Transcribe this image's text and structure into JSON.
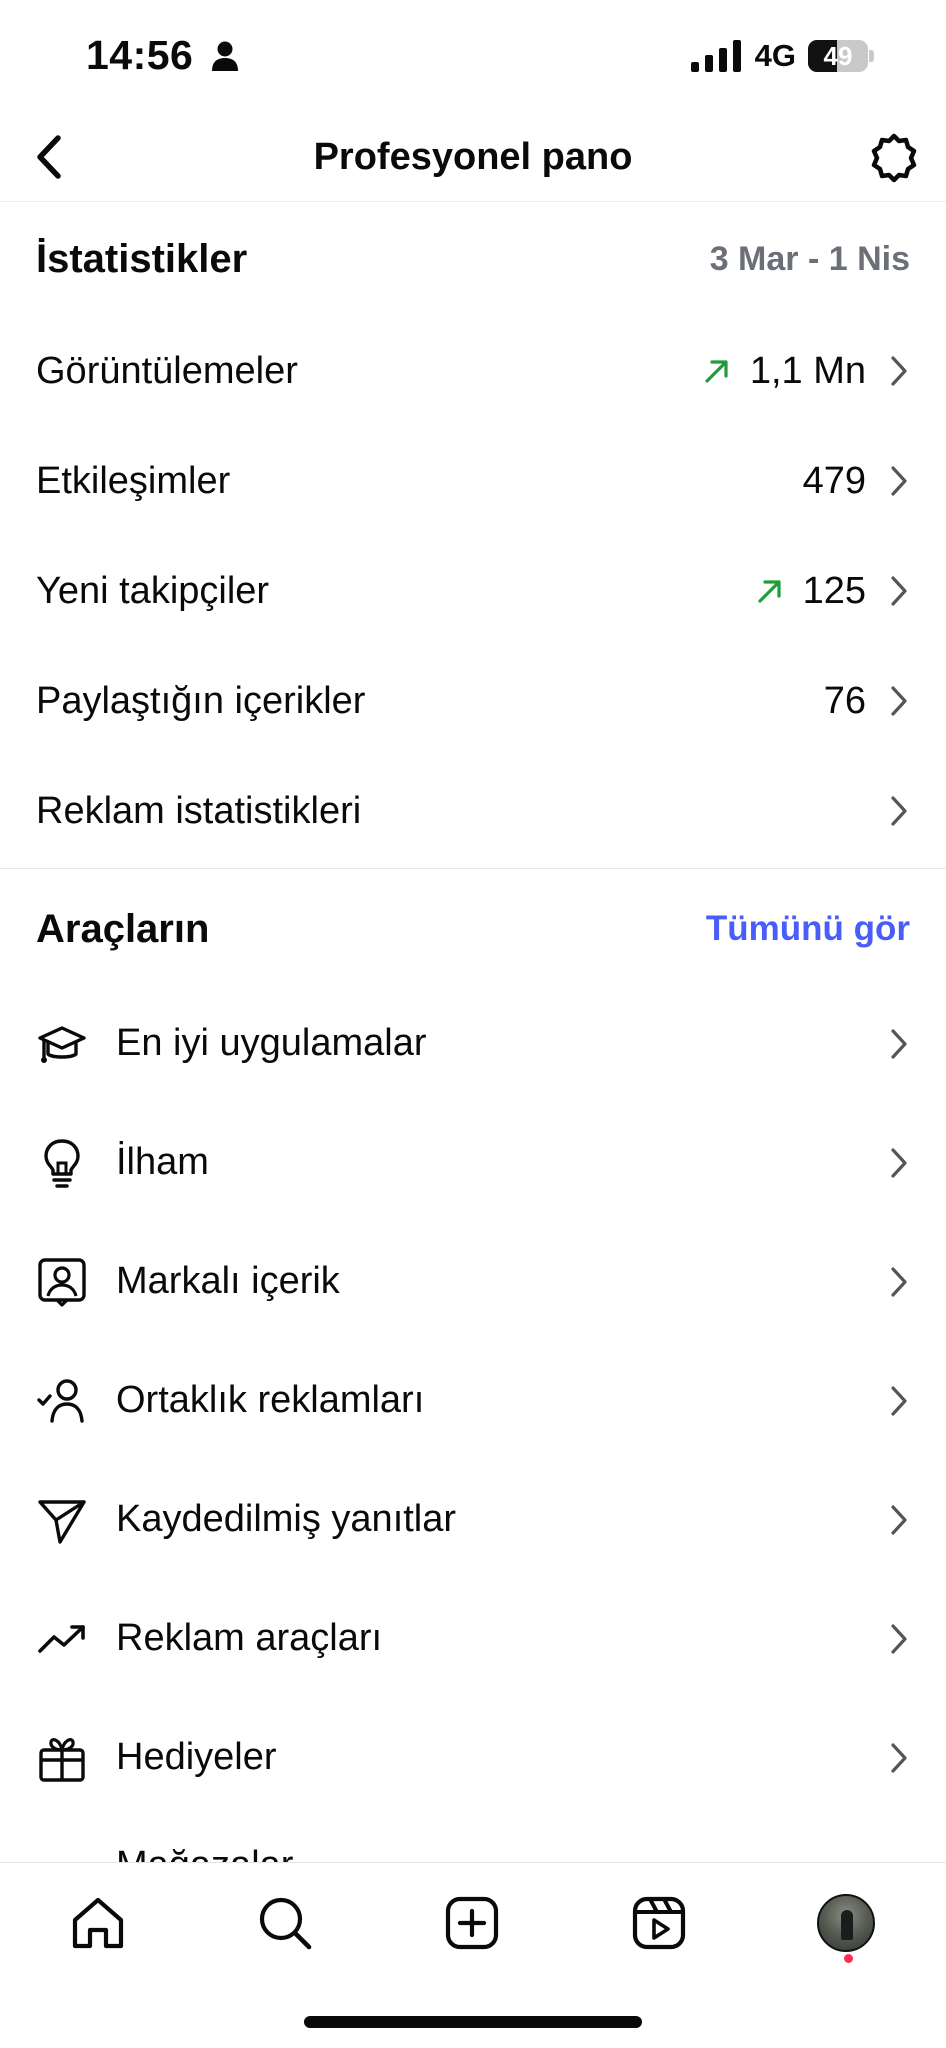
{
  "status_bar": {
    "time": "14:56",
    "network": "4G",
    "battery": "49",
    "battery_level": 0.49
  },
  "header": {
    "title": "Profesyonel pano"
  },
  "stats": {
    "title": "İstatistikler",
    "date_range": "3 Mar - 1 Nis",
    "rows": [
      {
        "label": "Görüntülemeler",
        "value": "1,1 Mn",
        "trend": "up"
      },
      {
        "label": "Etkileşimler",
        "value": "479",
        "trend": ""
      },
      {
        "label": "Yeni takipçiler",
        "value": "125",
        "trend": "up"
      },
      {
        "label": "Paylaştığın içerikler",
        "value": "76",
        "trend": ""
      },
      {
        "label": "Reklam istatistikleri",
        "value": "",
        "trend": ""
      }
    ]
  },
  "tools": {
    "title": "Araçların",
    "see_all": "Tümünü gör",
    "items": [
      {
        "label": "En iyi uygulamalar",
        "icon": "graduation-cap-icon"
      },
      {
        "label": "İlham",
        "icon": "lightbulb-icon"
      },
      {
        "label": "Markalı içerik",
        "icon": "branded-content-icon"
      },
      {
        "label": "Ortaklık reklamları",
        "icon": "partnership-icon"
      },
      {
        "label": "Kaydedilmiş yanıtlar",
        "icon": "paper-plane-icon"
      },
      {
        "label": "Reklam araçları",
        "icon": "trending-up-icon"
      },
      {
        "label": "Hediyeler",
        "icon": "gift-icon"
      },
      {
        "label": "Mağazalar",
        "icon": "shop-icon"
      }
    ]
  },
  "colors": {
    "trend_up": "#1f9d3b",
    "link": "#4a5df9",
    "meta": "#6b7078"
  }
}
